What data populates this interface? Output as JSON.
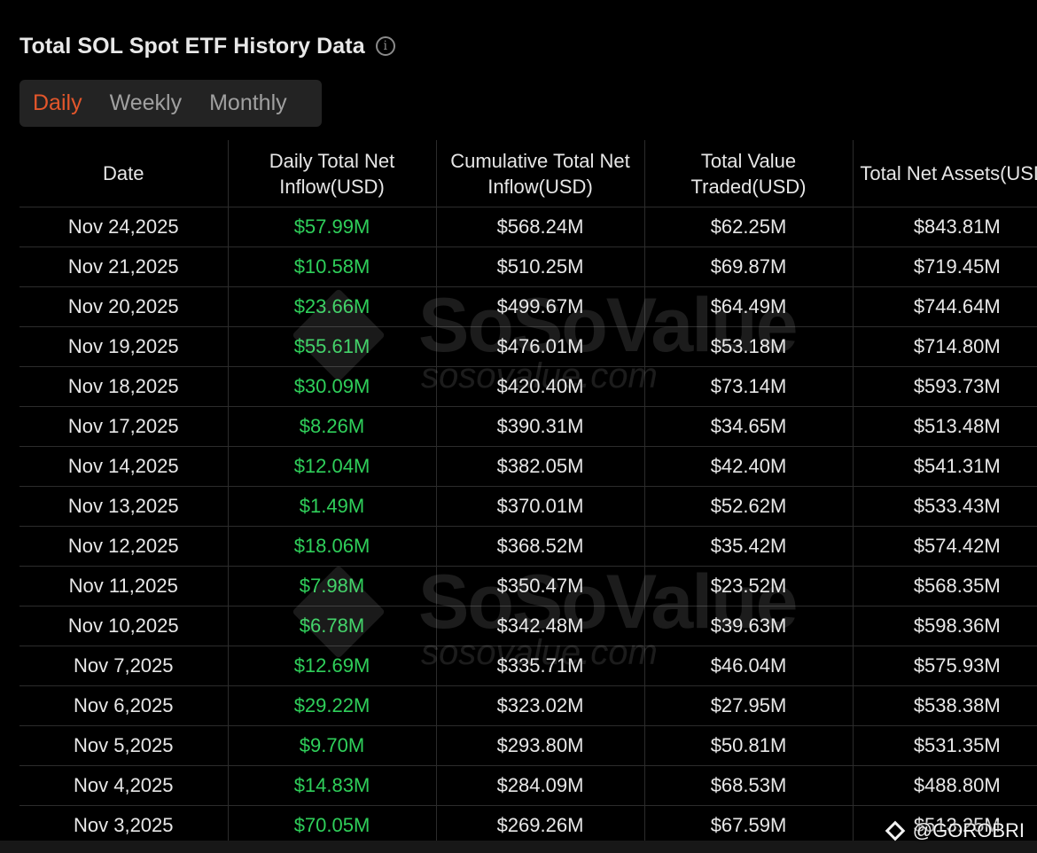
{
  "header": {
    "title": "Total SOL Spot ETF History Data",
    "info_icon": "info-icon"
  },
  "tabs": [
    {
      "label": "Daily",
      "active": true
    },
    {
      "label": "Weekly",
      "active": false
    },
    {
      "label": "Monthly",
      "active": false
    }
  ],
  "table": {
    "columns": [
      "Date",
      "Daily Total Net Inflow(USD)",
      "Cumulative Total Net Inflow(USD)",
      "Total Value Traded(USD)",
      "Total Net Assets(USD)"
    ],
    "rows": [
      [
        "Nov 24,2025",
        "$57.99M",
        "$568.24M",
        "$62.25M",
        "$843.81M"
      ],
      [
        "Nov 21,2025",
        "$10.58M",
        "$510.25M",
        "$69.87M",
        "$719.45M"
      ],
      [
        "Nov 20,2025",
        "$23.66M",
        "$499.67M",
        "$64.49M",
        "$744.64M"
      ],
      [
        "Nov 19,2025",
        "$55.61M",
        "$476.01M",
        "$53.18M",
        "$714.80M"
      ],
      [
        "Nov 18,2025",
        "$30.09M",
        "$420.40M",
        "$73.14M",
        "$593.73M"
      ],
      [
        "Nov 17,2025",
        "$8.26M",
        "$390.31M",
        "$34.65M",
        "$513.48M"
      ],
      [
        "Nov 14,2025",
        "$12.04M",
        "$382.05M",
        "$42.40M",
        "$541.31M"
      ],
      [
        "Nov 13,2025",
        "$1.49M",
        "$370.01M",
        "$52.62M",
        "$533.43M"
      ],
      [
        "Nov 12,2025",
        "$18.06M",
        "$368.52M",
        "$35.42M",
        "$574.42M"
      ],
      [
        "Nov 11,2025",
        "$7.98M",
        "$350.47M",
        "$23.52M",
        "$568.35M"
      ],
      [
        "Nov 10,2025",
        "$6.78M",
        "$342.48M",
        "$39.63M",
        "$598.36M"
      ],
      [
        "Nov 7,2025",
        "$12.69M",
        "$335.71M",
        "$46.04M",
        "$575.93M"
      ],
      [
        "Nov 6,2025",
        "$29.22M",
        "$323.02M",
        "$27.95M",
        "$538.38M"
      ],
      [
        "Nov 5,2025",
        "$9.70M",
        "$293.80M",
        "$50.81M",
        "$531.35M"
      ],
      [
        "Nov 4,2025",
        "$14.83M",
        "$284.09M",
        "$68.53M",
        "$488.80M"
      ],
      [
        "Nov 3,2025",
        "$70.05M",
        "$269.26M",
        "$67.59M",
        "$513.25M"
      ]
    ]
  },
  "watermark": {
    "name": "SoSoValue",
    "url": "sosovalue.com"
  },
  "credit": {
    "text": "@GOROBRI",
    "icon": "diamond-logo-icon"
  },
  "colors": {
    "accent": "#e3562b",
    "positive": "#2fcf5a",
    "background": "#000000",
    "tabs_bg": "#232323"
  }
}
